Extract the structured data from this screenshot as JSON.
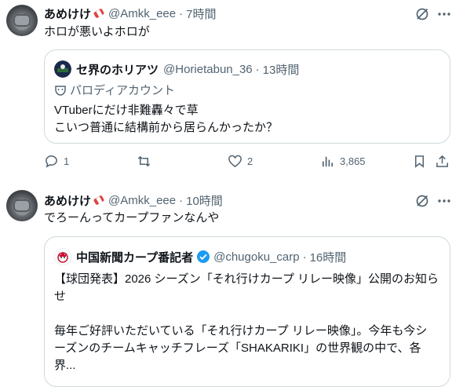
{
  "tweet1": {
    "name": "あめけけ",
    "handle": "@Amkk_eee",
    "time": "7時間",
    "text": "ホロが悪いよホロが",
    "quote": {
      "name": "セ界のホリアツ",
      "handle": "@Horietabun_36",
      "time": "13時間",
      "label": "パロディアカウント",
      "lines": [
        "VTuberにだけ非難轟々で草",
        "こいつ普通に結構前から居らんかったか？"
      ]
    },
    "actions": {
      "replies": "1",
      "reposts": "",
      "likes": "2",
      "views": "3,865"
    }
  },
  "tweet2": {
    "name": "あめけけ",
    "handle": "@Amkk_eee",
    "time": "10時間",
    "text": "でろーんってカープファンなんや",
    "quote": {
      "name": "中国新聞カープ番記者",
      "handle": "@chugoku_carp",
      "time": "16時間",
      "line1": "【球団発表】2026 シーズン「それ行けカープ リレー映像」公開のお知ら",
      "line2": "せ",
      "line3": "毎年ご好評いただいている「それ行けカープ リレー映像」。今年も今シ",
      "line4": "ーズンのチームキャッチフレーズ「SHAKARIKI」の世界観の中で、各界..."
    }
  },
  "dot": "·"
}
